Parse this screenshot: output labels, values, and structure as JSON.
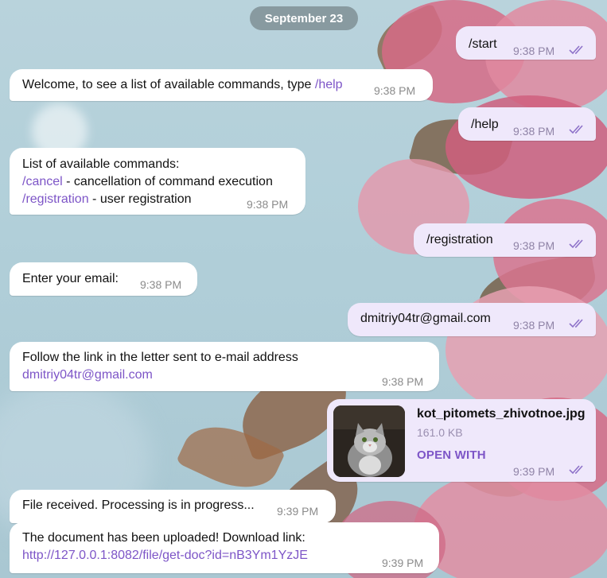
{
  "colors": {
    "incoming_bubble": "#ffffff",
    "outgoing_bubble": "#efe8fb",
    "accent": "#7d55c7",
    "date_pill": "#78878c"
  },
  "date_separator": "September 23",
  "messages": [
    {
      "dir": "out",
      "text": "/start",
      "time": "9:38 PM",
      "read": true
    },
    {
      "dir": "in",
      "text_before": "Welcome, to see a list of available commands, type ",
      "cmd": "/help",
      "time": "9:38 PM"
    },
    {
      "dir": "out",
      "text": "/help",
      "time": "9:38 PM",
      "read": true
    },
    {
      "dir": "in",
      "line1": "List of available commands:",
      "cmd1": "/cancel",
      "desc1": " - cancellation of command execution",
      "cmd2": "/registration",
      "desc2": " - user registration",
      "time": "9:38 PM"
    },
    {
      "dir": "out",
      "text": "/registration",
      "time": "9:38 PM",
      "read": true
    },
    {
      "dir": "in",
      "text": "Enter your email:",
      "time": "9:38 PM"
    },
    {
      "dir": "out",
      "text": "dmitriy04tr@gmail.com",
      "time": "9:38 PM",
      "read": true
    },
    {
      "dir": "in",
      "line1": "Follow the link in the letter sent to e-mail address",
      "link": "dmitriy04tr@gmail.com",
      "time": "9:38 PM"
    },
    {
      "dir": "out",
      "type": "file",
      "file_name": "kot_pitomets_zhivotnoe.jpg",
      "file_size": "161.0 KB",
      "action": "OPEN WITH",
      "thumbnail": "cat-photo",
      "time": "9:39 PM",
      "read": true
    },
    {
      "dir": "in",
      "text": "File received. Processing is in progress...",
      "time": "9:39 PM"
    },
    {
      "dir": "in",
      "line1": "The document has been uploaded! Download link:",
      "link": "http://127.0.0.1:8082/file/get-doc?id=nB3Ym1YzJE",
      "time": "9:39 PM"
    }
  ]
}
